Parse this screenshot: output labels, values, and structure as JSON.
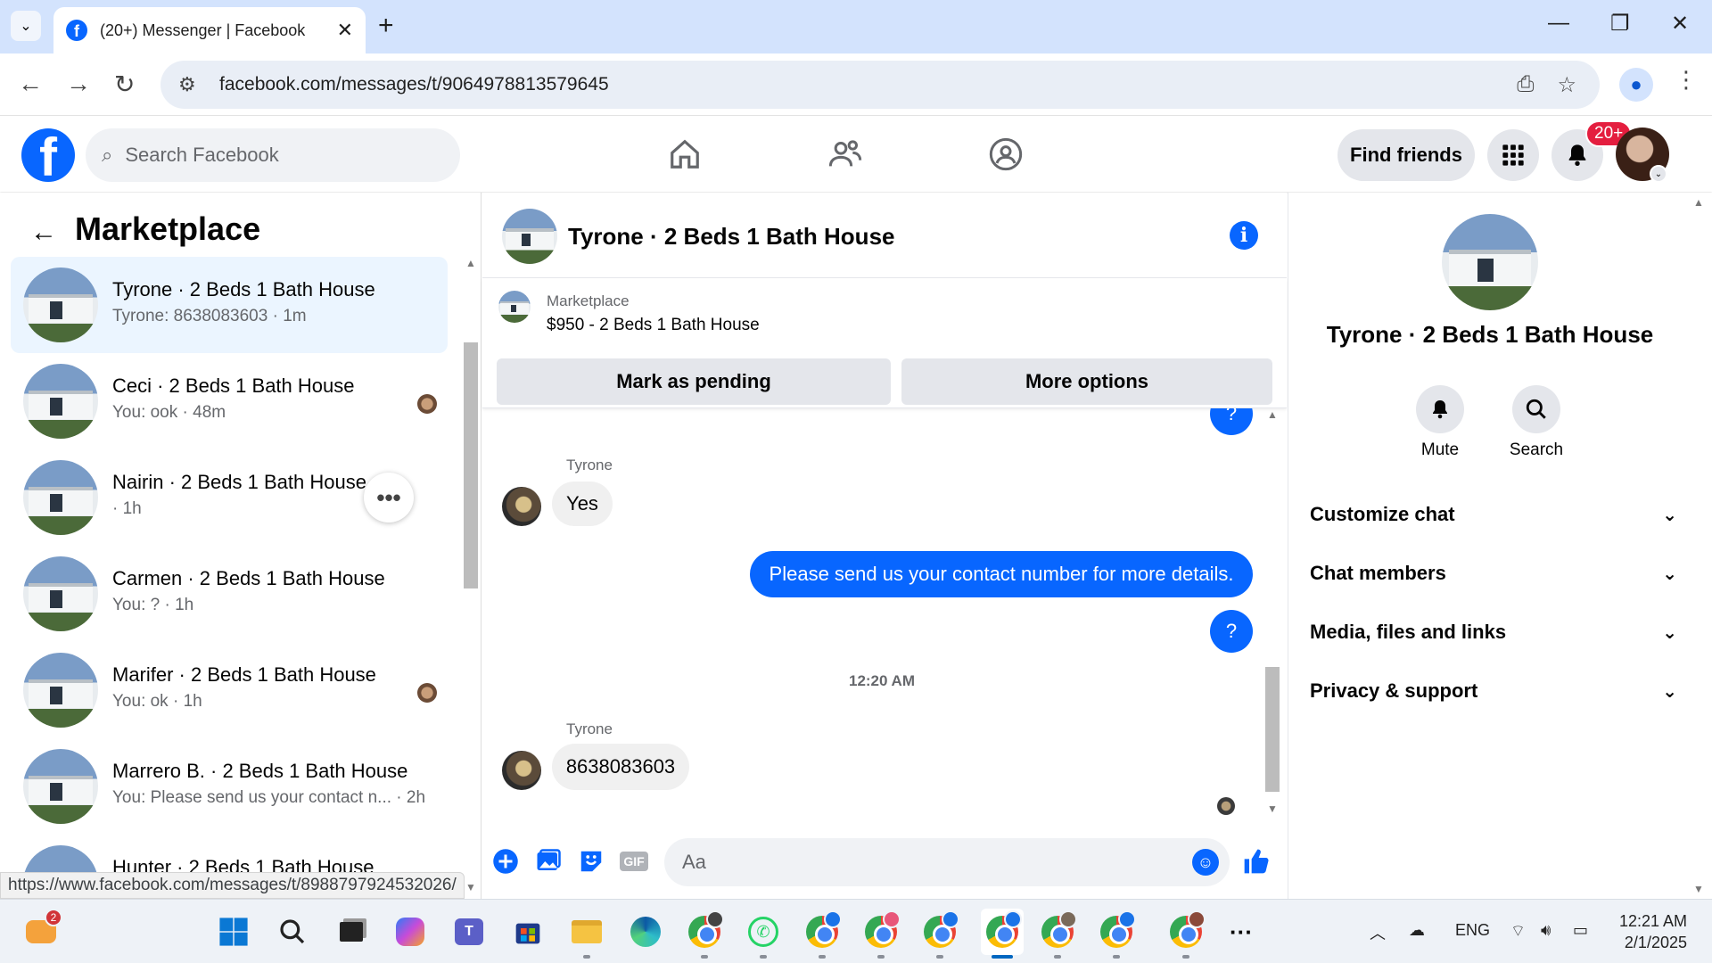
{
  "browser": {
    "tab_title": "(20+) Messenger | Facebook",
    "url": "facebook.com/messages/t/9064978813579645",
    "status_url": "https://www.facebook.com/messages/t/8988797924532026/"
  },
  "fb_header": {
    "search_placeholder": "Search Facebook",
    "find_friends": "Find friends",
    "notif_count": "20+",
    "brand_color": "#0866ff"
  },
  "left_panel": {
    "title": "Marketplace",
    "conversations": [
      {
        "name": "Tyrone · 2 Beds 1 Bath House",
        "preview": "Tyrone: 8638083603 · 1m"
      },
      {
        "name": "Ceci · 2 Beds 1 Bath House",
        "preview": "You: ook · 48m"
      },
      {
        "name": "Nairin · 2 Beds 1 Bath House",
        "preview": " · 1h"
      },
      {
        "name": "Carmen · 2 Beds 1 Bath House",
        "preview": "You: ? · 1h"
      },
      {
        "name": "Marifer · 2 Beds 1 Bath House",
        "preview": "You: ok · 1h"
      },
      {
        "name": "Marrero B. · 2 Beds 1 Bath House",
        "preview": "You: Please send us your contact n... · 2h"
      },
      {
        "name": "Hunter · 2 Beds 1 Bath House",
        "preview": ""
      }
    ]
  },
  "chat": {
    "title": "Tyrone · 2 Beds 1 Bath House",
    "marketplace_label": "Marketplace",
    "listing": "$950 - 2 Beds 1 Bath House",
    "mark_pending": "Mark as pending",
    "more_options": "More options",
    "messages": {
      "out_q_top": "?",
      "sender1": "Tyrone",
      "in_yes": "Yes",
      "out_contact": "Please send us your contact number for more details.",
      "out_q": "?",
      "timestamp": "12:20 AM",
      "sender2": "Tyrone",
      "in_number": "8638083603"
    },
    "composer_placeholder": "Aa",
    "gif_label": "GIF"
  },
  "right_panel": {
    "name": "Tyrone · 2 Beds 1 Bath House",
    "mute": "Mute",
    "search": "Search",
    "sections": [
      "Customize chat",
      "Chat members",
      "Media, files and links",
      "Privacy & support"
    ]
  },
  "taskbar": {
    "lang": "ENG",
    "time": "12:21 AM",
    "date": "2/1/2025",
    "weather_badge": "2"
  }
}
